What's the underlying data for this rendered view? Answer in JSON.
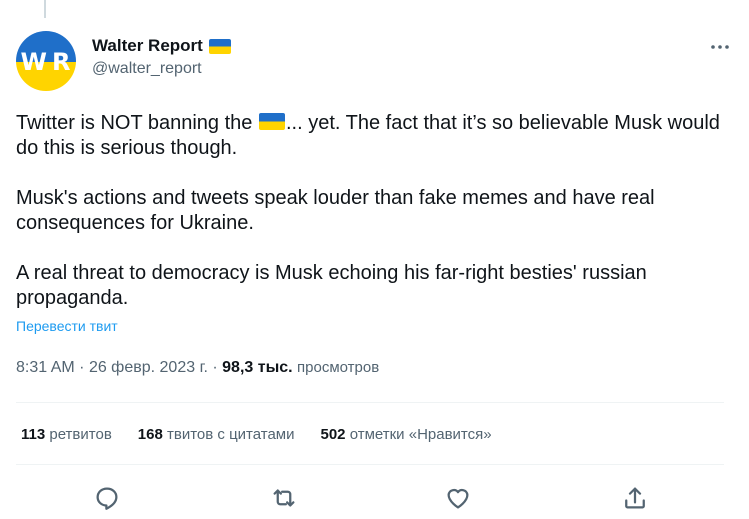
{
  "author": {
    "display_name": "Walter Report",
    "handle": "@walter_report",
    "avatar_initials": [
      "W",
      "R"
    ],
    "flag_icon": "ukraine-flag"
  },
  "tweet": {
    "p1_before_flag": "Twitter is NOT banning the ",
    "p1_after_flag": "... yet. The fact that it’s so believable Musk would do this is serious though.",
    "p2": "Musk's actions and tweets speak louder than fake memes and have real consequences for Ukraine.",
    "p3": "A real threat to democracy is Musk echoing his far-right besties' russian propaganda.",
    "translate_label": "Перевести твит"
  },
  "meta": {
    "time": "8:31 AM",
    "separator": "·",
    "date": "26 февр. 2023 г.",
    "views_count": "98,3 тыс.",
    "views_label": "просмотров"
  },
  "stats": {
    "retweets": {
      "count": "113",
      "label": "ретвитов"
    },
    "quotes": {
      "count": "168",
      "label": "твитов с цитатами"
    },
    "likes": {
      "count": "502",
      "label": "отметки «Нравится»"
    }
  },
  "actions": [
    "reply-icon",
    "retweet-icon",
    "like-icon",
    "share-icon"
  ],
  "colors": {
    "accent": "#1d9bf0",
    "text": "#0f1419",
    "secondary": "#536471",
    "divider": "#eff3f4",
    "flag_blue": "#1f6fc9",
    "flag_yellow": "#ffd400"
  }
}
